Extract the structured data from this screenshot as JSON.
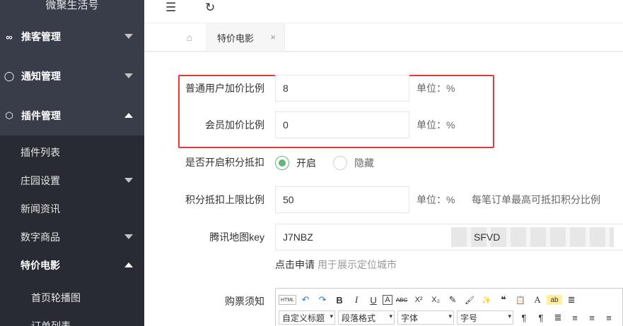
{
  "sidebar": {
    "brand": "微聚生活号",
    "top_items": [
      {
        "label": "推客管理",
        "icon": "∞"
      },
      {
        "label": "通知管理",
        "icon": "◯"
      },
      {
        "label": "插件管理",
        "icon": "⬡"
      }
    ],
    "sub_items": [
      {
        "label": "插件列表"
      },
      {
        "label": "庄园设置"
      },
      {
        "label": "新闻资讯"
      },
      {
        "label": "数字商品"
      },
      {
        "label": "特价电影"
      },
      {
        "label": "首页轮播图"
      },
      {
        "label": "订单列表"
      }
    ]
  },
  "header": {
    "collapse_icon": "☰",
    "refresh_icon": "↻"
  },
  "tabs": {
    "home_icon": "⌂",
    "active_label": "特价电影",
    "close": "×"
  },
  "form": {
    "normal_markup_label": "普通用户加价比例",
    "normal_markup_value": "8",
    "member_markup_label": "会员加价比例",
    "member_markup_value": "0",
    "unit": "单位：%",
    "points_label": "是否开启积分抵扣",
    "points_on": "开启",
    "points_off": "隐藏",
    "points_limit_label": "积分抵扣上限比例",
    "points_limit_value": "50",
    "points_limit_hint": "每笔订单最高可抵扣积分比例",
    "map_key_label": "腾讯地图key",
    "map_key_prefix": "J7NBZ",
    "map_key_suffix": "SFVD",
    "apply_link": "点击申请",
    "apply_desc": "用于展示定位城市",
    "notice_label": "购票须知"
  },
  "editor": {
    "row1": [
      "HTML",
      "↶",
      "↷",
      "B",
      "I",
      "U",
      "A",
      "ABC",
      "X²",
      "X₂",
      "✎",
      "🖌",
      "✨",
      "❝",
      "📋",
      "A",
      "ab",
      "≣"
    ],
    "row2_selects": [
      "自定义标题",
      "段落格式",
      "字体",
      "字号"
    ],
    "row2_btns": [
      "¶",
      "¶",
      "≣",
      "≡",
      "≡",
      "≡"
    ]
  },
  "colors": {
    "sidebar": "#393d49",
    "submenu": "#282b33",
    "highlight_border": "#e4393c",
    "radio_on": "#5fb878"
  }
}
